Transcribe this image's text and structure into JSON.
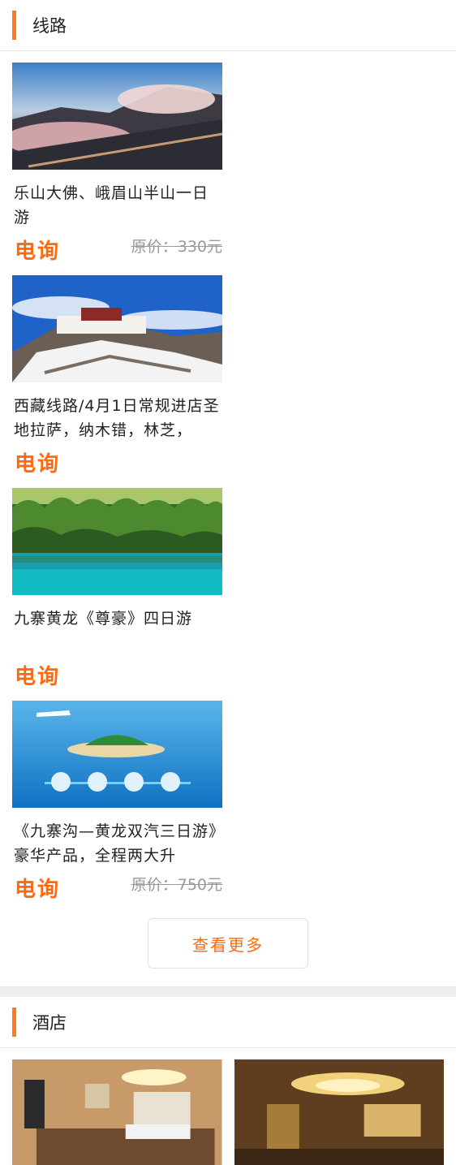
{
  "routes": {
    "title": "线路",
    "more_label": "查看更多",
    "items": [
      {
        "title": "乐山大佛、峨眉山半山一日游",
        "price_label": "电询",
        "original_price": "原价：330元",
        "image": "mountain-clouds-photo"
      },
      {
        "title": "西藏线路/4月1日常规进店圣地拉萨，纳木错，林芝，",
        "price_label": "电询",
        "original_price": "",
        "image": "potala-palace-photo"
      },
      {
        "title": "九寨黄龙《尊豪》四日游",
        "price_label": "电询",
        "original_price": "",
        "image": "jiuzhai-lake-photo"
      },
      {
        "title": "《九寨沟—黄龙双汽三日游》豪华产品，全程两大升",
        "price_label": "电询",
        "original_price": "原价：750元",
        "image": "maldives-island-photo"
      }
    ]
  },
  "hotels": {
    "title": "酒店",
    "items": [
      {
        "image": "hotel-room-photo"
      },
      {
        "image": "hotel-lobby-photo"
      }
    ]
  },
  "colors": {
    "accent": "#ff7a22",
    "price": "#ff6a10"
  }
}
